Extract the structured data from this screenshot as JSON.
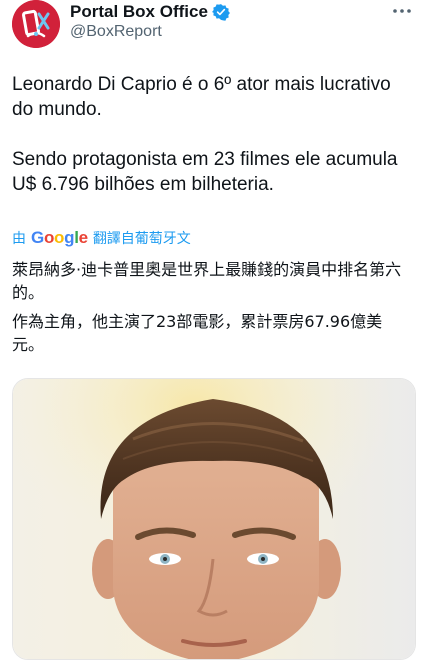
{
  "account": {
    "display_name": "Portal Box Office",
    "handle": "@BoxReport",
    "avatar_icon": "box-office-logo-icon",
    "avatar_color": "#d1213a",
    "verified_color": "#1d9bf0"
  },
  "tweet": {
    "paragraph_1": "Leonardo Di Caprio é o 6º ator mais lucrativo do mundo.",
    "paragraph_2": "Sendo protagonista em 23 filmes ele acumula U$ 6.796 bilhões em bilheteria."
  },
  "translation": {
    "prefix": "由",
    "provider_letters": [
      "G",
      "o",
      "o",
      "g",
      "l",
      "e"
    ],
    "suffix": "翻譯自葡萄牙文",
    "line_1": "萊昂納多·迪卡普里奧是世界上最賺錢的演員中排名第六的。",
    "line_2": "作為主角，他主演了23部電影，累計票房67.96億美元。"
  },
  "media": {
    "icon": "photo-icon"
  }
}
